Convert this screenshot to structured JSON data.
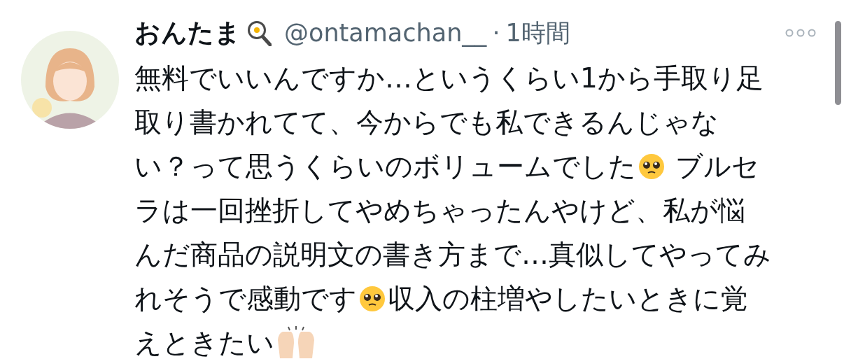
{
  "tweet": {
    "author": {
      "name": "おんたま",
      "handle": "@ontamachan__",
      "separator": "·",
      "time": "1時間"
    },
    "lines": [
      [
        {
          "kind": "text",
          "text": "無料でいいんですか…というくらい1から手取り足"
        }
      ],
      [
        {
          "kind": "text",
          "text": "取り書かれてて、今からでも私できるんじゃな"
        }
      ],
      [
        {
          "kind": "text",
          "text": "い？って思うくらいのボリュームでした"
        },
        {
          "kind": "pleading"
        },
        {
          "kind": "text",
          "text": " ブルセ"
        }
      ],
      [
        {
          "kind": "text",
          "text": "ラは一回挫折してやめちゃったんやけど、私が悩"
        }
      ],
      [
        {
          "kind": "text",
          "text": "んだ商品の説明文の書き方まで…真似してやってみ"
        }
      ],
      [
        {
          "kind": "text",
          "text": "れそうで感動です"
        },
        {
          "kind": "pleading"
        },
        {
          "kind": "text",
          "text": "収入の柱増やしたいときに覚"
        }
      ],
      [
        {
          "kind": "text",
          "text": "えときたい"
        },
        {
          "kind": "hands"
        }
      ]
    ]
  }
}
